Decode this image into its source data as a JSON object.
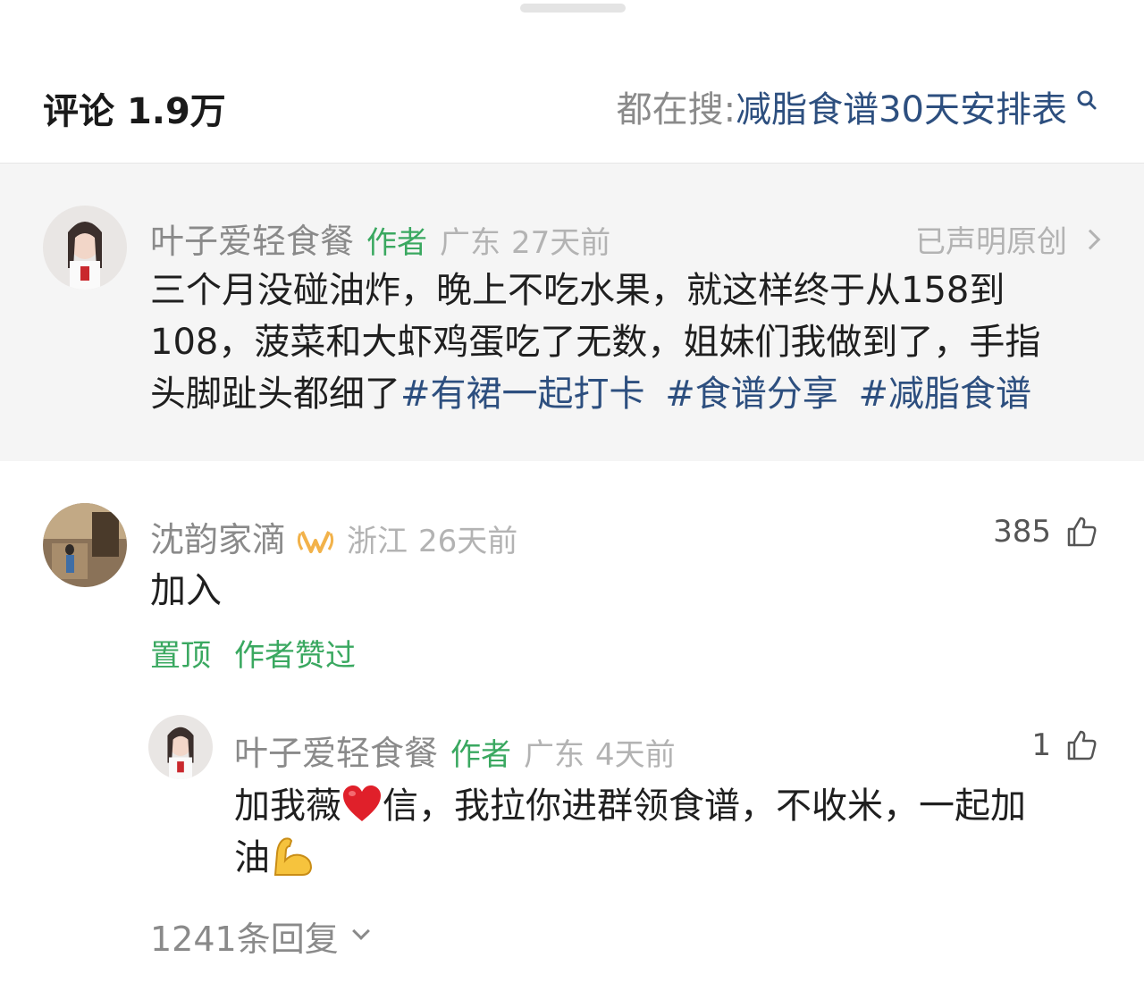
{
  "header": {
    "comment_label": "评论",
    "comment_count": "1.9万",
    "search_prefix": "都在搜:",
    "search_query": "减脂食谱30天安排表"
  },
  "pinned_post": {
    "author": "叶子爱轻食餐",
    "author_tag": "作者",
    "location": "广东",
    "time": "27天前",
    "original_label": "已声明原创",
    "text_line1": "三个月没碰油炸，晚上不吃水果，就这样终于从158到",
    "text_line2": "108，菠菜和大虾鸡蛋吃了无数，姐妹们我做到了，手指",
    "text_line3_plain": "头脚趾头都细了",
    "hashtags": [
      "#有裙一起打卡",
      "#食谱分享",
      "#减脂食谱"
    ]
  },
  "comment": {
    "author": "沈韵家滴",
    "location": "浙江",
    "time": "26天前",
    "likes": "385",
    "text": "加入",
    "pinned_label": "置顶",
    "author_liked_label": "作者赞过"
  },
  "reply": {
    "author": "叶子爱轻食餐",
    "author_tag": "作者",
    "location": "广东",
    "time": "4天前",
    "likes": "1",
    "text_part1": "加我薇",
    "text_part2": "信，我拉你进群领食谱，不收米，一起加",
    "text_line2": "油"
  },
  "replies_footer": {
    "label": "1241条回复"
  },
  "colors": {
    "link_blue": "#2d4f7f",
    "author_green": "#3aa860",
    "pinned_bg": "#f5f5f5"
  }
}
